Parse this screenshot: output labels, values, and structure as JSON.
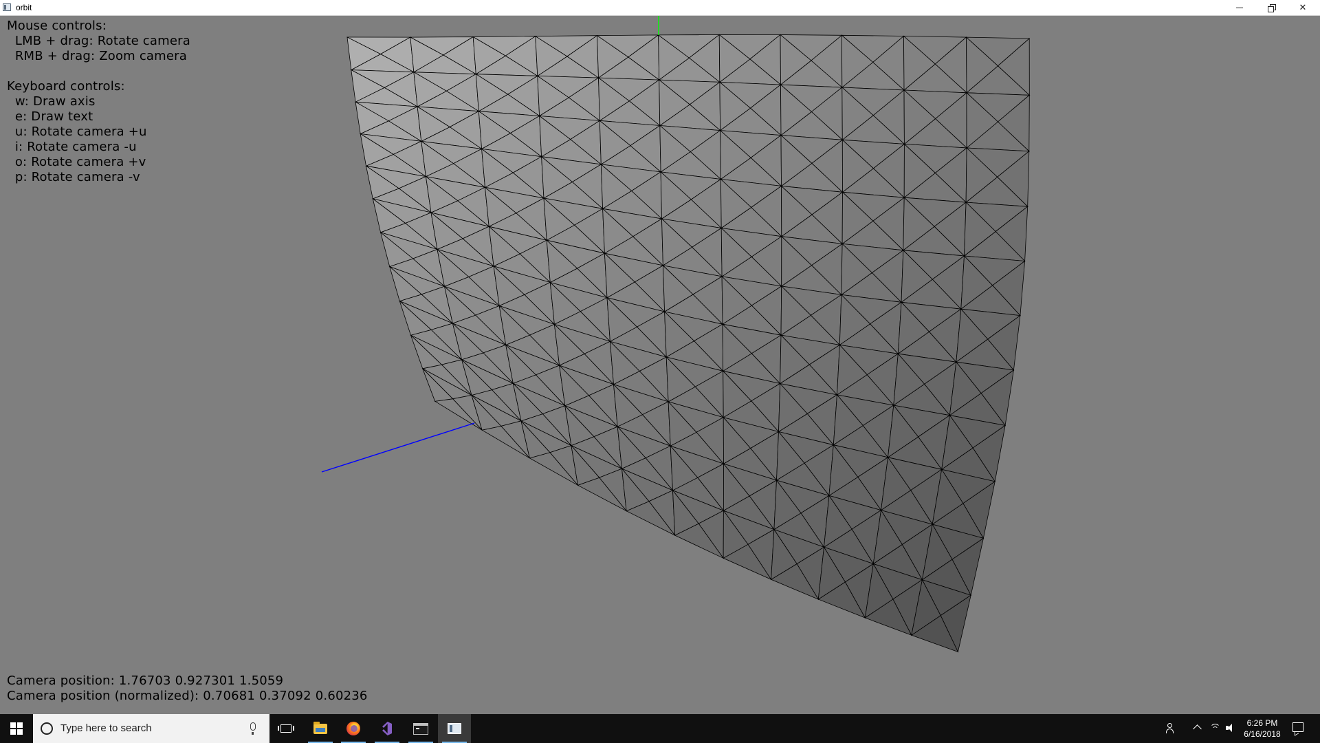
{
  "window": {
    "title": "orbit",
    "controls": [
      "minimize",
      "restore",
      "close"
    ]
  },
  "overlay": {
    "mouse_header": "Mouse controls:",
    "mouse_controls": [
      "  LMB + drag: Rotate camera",
      "  RMB + drag: Zoom camera"
    ],
    "keyboard_header": "Keyboard controls:",
    "keyboard_controls": [
      "  w: Draw axis",
      "  e: Draw text",
      "  u: Rotate camera +u",
      "  i: Rotate camera -u",
      "  o: Rotate camera +v",
      "  p: Rotate camera -v"
    ],
    "camera_position": "Camera position: 1.76703 0.927301 1.5059",
    "camera_position_normalized": "Camera position (normalized): 0.70681 0.37092 0.60236"
  },
  "scene": {
    "background": "#7f7f7f",
    "mesh_edge_color": "#000000",
    "axes": [
      {
        "name": "x-axis",
        "color": "#0000ff"
      },
      {
        "name": "y-axis",
        "color": "#00ff00"
      }
    ]
  },
  "taskbar": {
    "search_placeholder": "Type here to search",
    "pinned": [
      {
        "name": "task-view-icon",
        "active": false
      },
      {
        "name": "file-explorer-icon",
        "active": true
      },
      {
        "name": "firefox-icon",
        "active": true
      },
      {
        "name": "visual-studio-icon",
        "active": true
      },
      {
        "name": "console-icon",
        "active": true
      },
      {
        "name": "orbit-app-icon",
        "active": true
      }
    ],
    "clock": {
      "time": "6:26 PM",
      "date": "6/16/2018"
    }
  }
}
